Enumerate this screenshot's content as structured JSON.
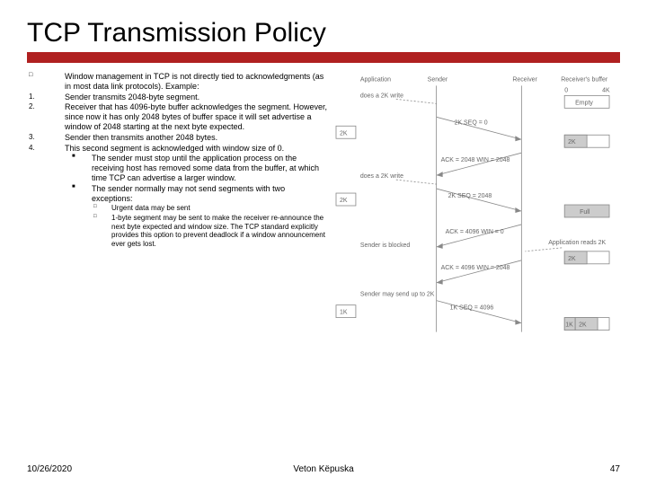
{
  "title": "TCP Transmission Policy",
  "bullets": {
    "intro": "Window management in TCP is not directly tied to acknowledgments (as in most data link protocols). Example:",
    "n1": "Sender transmits 2048-byte segment.",
    "n2": "Receiver that has 4096-byte buffer acknowledges the segment. However, since now it has only 2048 bytes of buffer space it will set advertise a window of 2048 starting at the next byte expected.",
    "n3": "Sender then transmits another 2048 bytes.",
    "n4": "This second segment is acknowledged with window size of 0.",
    "s1": "The sender must stop until the application process on the receiving host has removed some data from the buffer, at which time TCP can advertise a larger window.",
    "s2": "The sender normally may not send segments with two exceptions:",
    "e1": "Urgent data may be sent",
    "e2": "1-byte segment may be sent to make the receiver re-announce the next byte expected and window size. The TCP standard explicitly provides this option to prevent deadlock if a window announcement ever gets lost."
  },
  "diagram": {
    "sender": "Sender",
    "receiver": "Receiver",
    "application": "Application",
    "recvbuf": "Receiver's buffer",
    "does2k": "does a 2K write",
    "zero": "0",
    "fourk": "4K",
    "empty": "Empty",
    "twok": "2K",
    "onek": "1K",
    "seq0": "2K   SEQ = 0",
    "ack1": "ACK = 2048 WIN = 2048",
    "seq2": "2K   SEQ = 2048",
    "full": "Full",
    "ack2": "ACK = 4096 WIN = 0",
    "blocked": "Sender is blocked",
    "reads2k": "Application reads 2K",
    "ack3": "ACK = 4096 WIN = 2048",
    "mayup2k": "Sender may send up to 2K",
    "seq4": "1K   SEQ = 4096"
  },
  "footer": {
    "date": "10/26/2020",
    "author": "Veton Këpuska",
    "page": "47"
  }
}
